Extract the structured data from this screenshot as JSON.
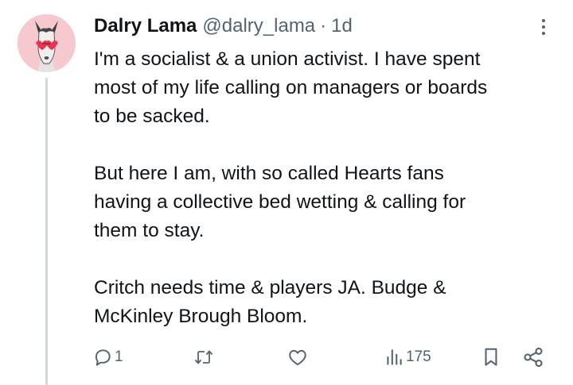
{
  "tweet": {
    "display_name": "Dalry Lama",
    "handle": "@dalry_lama",
    "separator": "·",
    "time": "1d",
    "paragraphs": [
      "I'm a socialist & a union activist. I have spent\nmost of my life calling on managers or boards\nto be sacked.",
      "But here I am, with so called Hearts fans\nhaving a collective bed wetting & calling for\nthem to stay.",
      "Critch needs time & players JA. Budge &\nMcKinley Brough Bloom."
    ]
  },
  "actions": {
    "reply_count": "1",
    "views_count": "175",
    "icons": [
      "reply-icon",
      "retweet-icon",
      "like-icon",
      "views-icon",
      "bookmark-icon",
      "share-icon"
    ]
  },
  "colors": {
    "text": "#0f1419",
    "secondary": "#536471",
    "thread_line": "#cfd9de",
    "avatar_bg": "#f6c9cf"
  }
}
